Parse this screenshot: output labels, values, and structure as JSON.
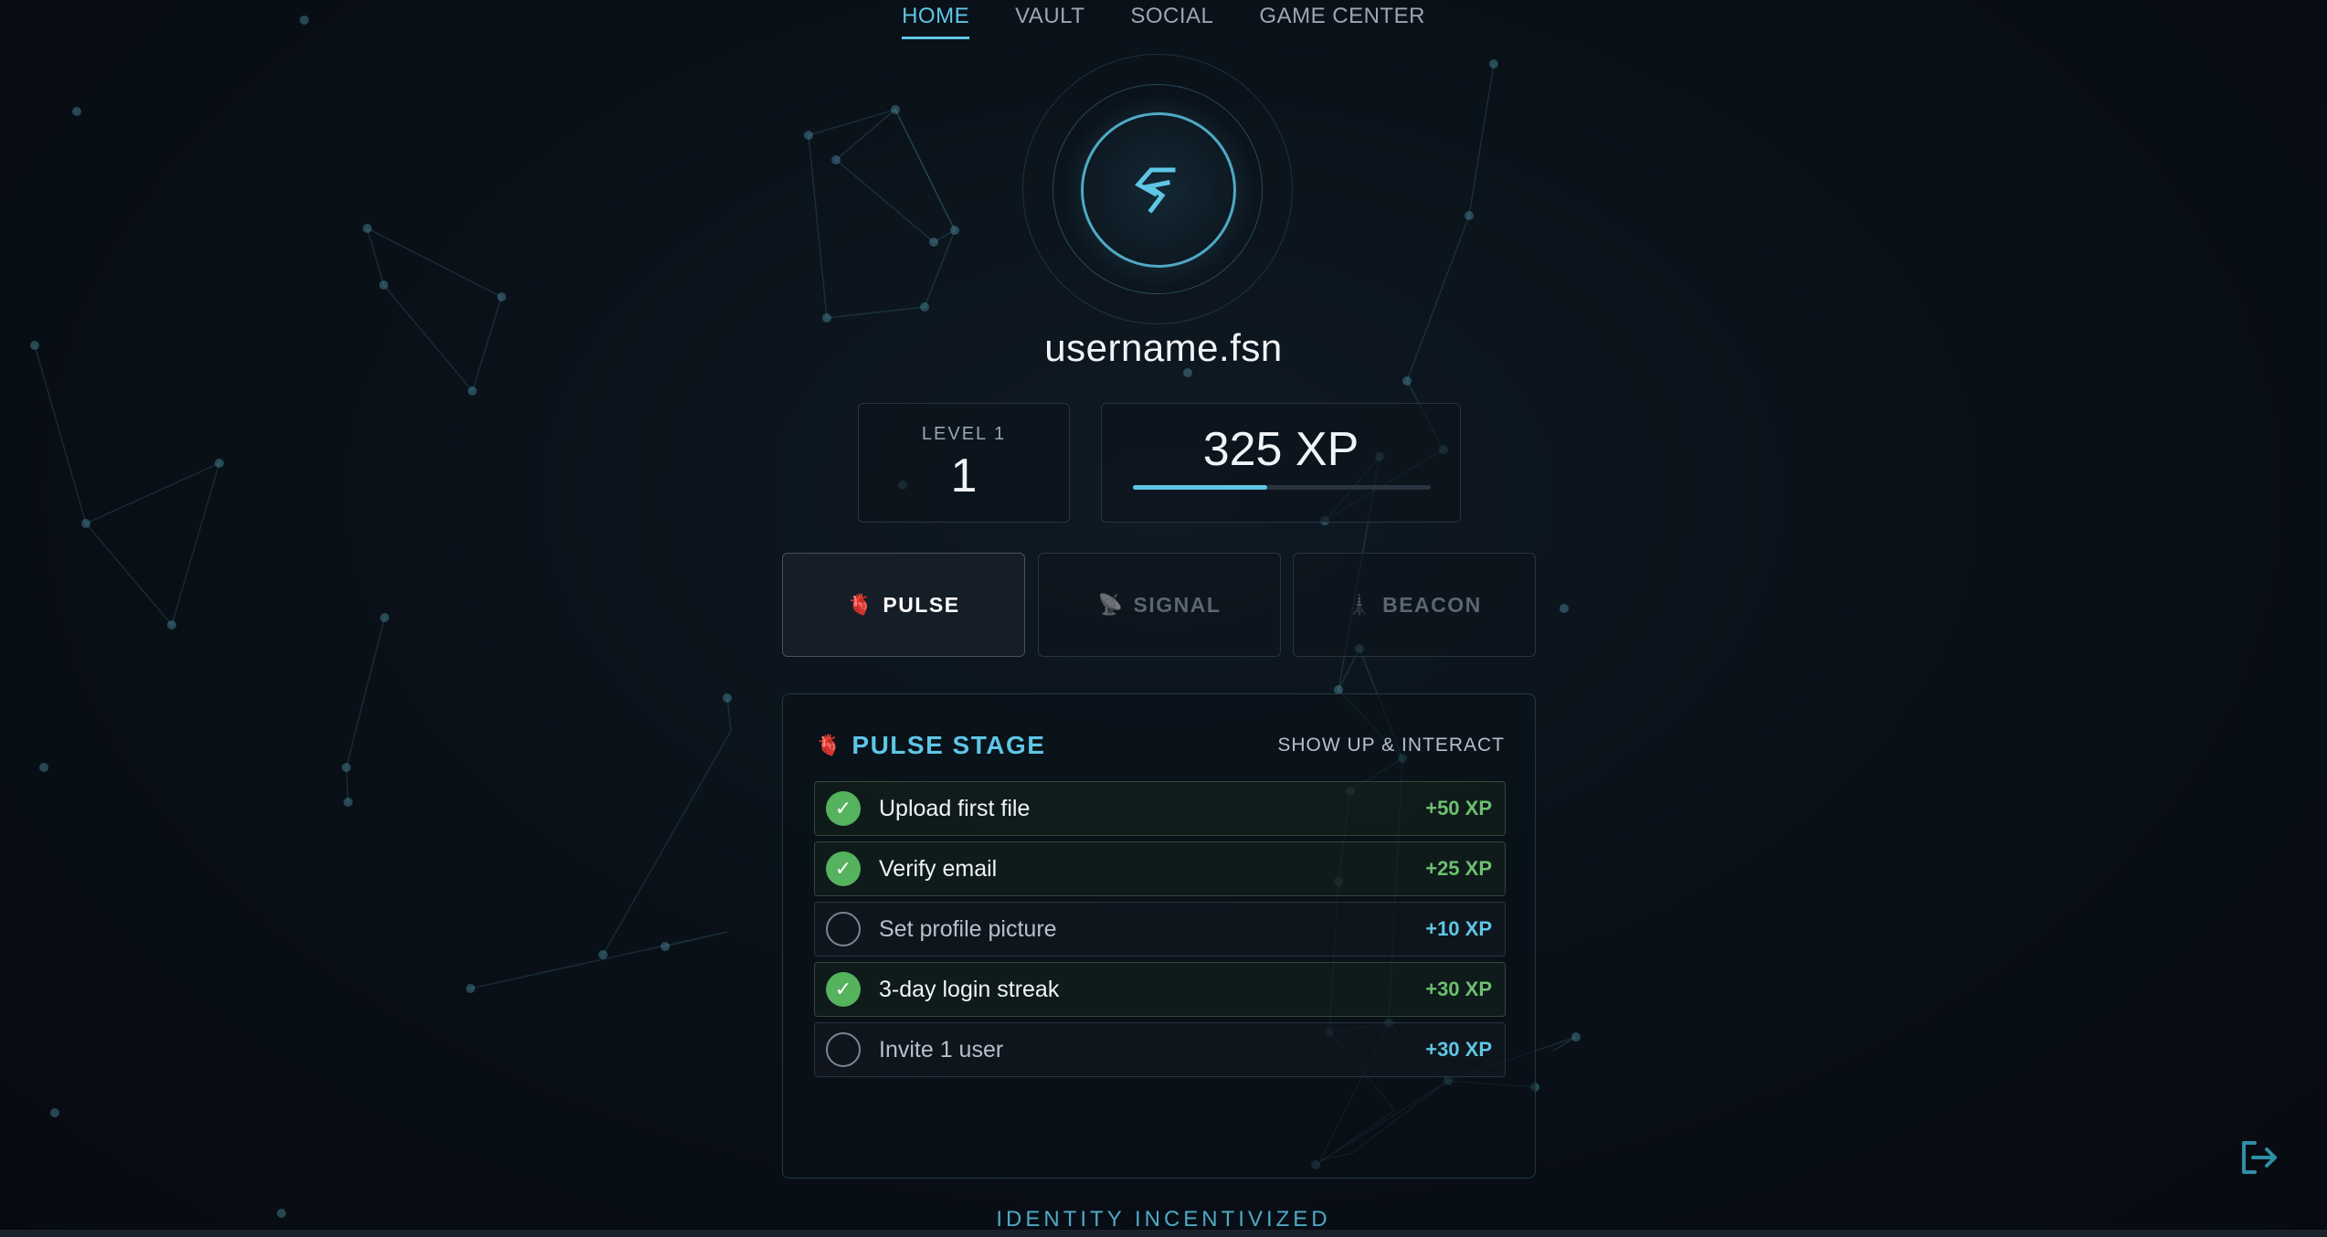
{
  "nav": {
    "tabs": [
      {
        "label": "HOME",
        "active": true
      },
      {
        "label": "VAULT",
        "active": false
      },
      {
        "label": "SOCIAL",
        "active": false
      },
      {
        "label": "GAME CENTER",
        "active": false
      }
    ]
  },
  "profile": {
    "avatar_icon": "bolt-logo-icon",
    "username": "username.fsn"
  },
  "stats": {
    "level_label": "LEVEL 1",
    "level_value": "1",
    "xp_label": "325 XP",
    "xp_progress_fraction": 0.45
  },
  "stage_tabs": [
    {
      "icon": "heart-icon",
      "glyph": "🫀",
      "label": "PULSE",
      "active": true
    },
    {
      "icon": "satellite-icon",
      "glyph": "📡",
      "label": "SIGNAL",
      "active": false
    },
    {
      "icon": "beacon-icon",
      "glyph": "🗼",
      "label": "BEACON",
      "active": false
    }
  ],
  "panel": {
    "icon": "heart-icon",
    "glyph": "🫀",
    "title": "PULSE STAGE",
    "subtitle": "SHOW UP & INTERACT",
    "tasks": [
      {
        "label": "Upload first file",
        "xp": "+50 XP",
        "done": true
      },
      {
        "label": "Verify email",
        "xp": "+25 XP",
        "done": true
      },
      {
        "label": "Set profile picture",
        "xp": "+10 XP",
        "done": false
      },
      {
        "label": "3-day login streak",
        "xp": "+30 XP",
        "done": true
      },
      {
        "label": "Invite 1 user",
        "xp": "+30 XP",
        "done": false
      }
    ]
  },
  "footer": {
    "brand": "IDENTITY INCENTIVIZED"
  },
  "colors": {
    "accent": "#5fc6e6",
    "success": "#55b25d",
    "background": "#0a0f16"
  }
}
